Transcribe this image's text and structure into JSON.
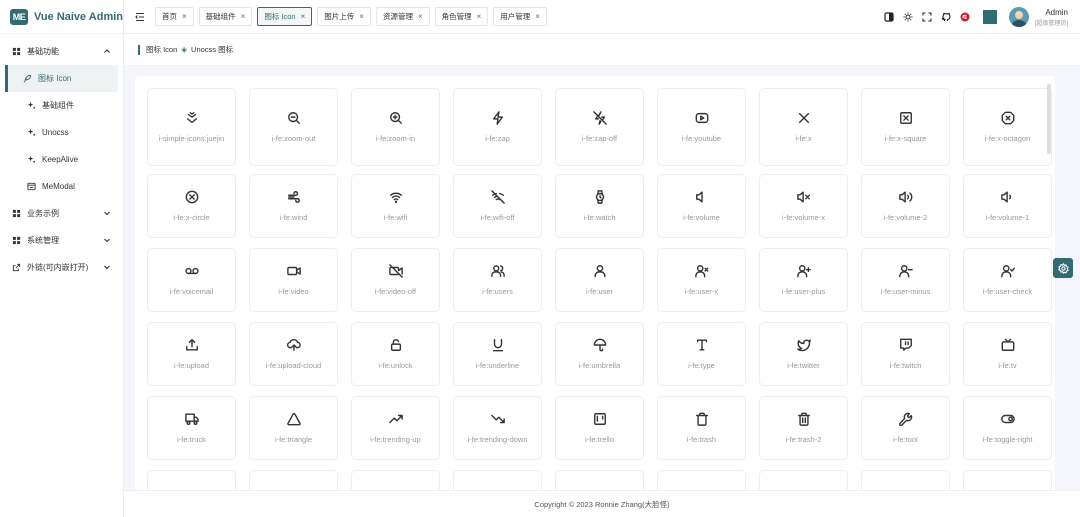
{
  "app": {
    "logo_badge": "ME",
    "title": "Vue Naive Admin"
  },
  "sidebar": {
    "items": [
      {
        "label": "基础功能",
        "level": 1,
        "icon": "grid-icon",
        "expanded": true
      },
      {
        "label": "图标 Icon",
        "level": 2,
        "icon": "feather-icon",
        "active": true
      },
      {
        "label": "基础组件",
        "level": 2,
        "icon": "sparkle-icon"
      },
      {
        "label": "Unocss",
        "level": 2,
        "icon": "sparkle-icon"
      },
      {
        "label": "KeepAlive",
        "level": 2,
        "icon": "sparkle-icon"
      },
      {
        "label": "MeModal",
        "level": 2,
        "icon": "window-icon"
      },
      {
        "label": "业务示例",
        "level": 1,
        "icon": "grid-icon"
      },
      {
        "label": "系统管理",
        "level": 1,
        "icon": "grid-icon"
      },
      {
        "label": "外链(可内嵌打开)",
        "level": 1,
        "icon": "external-link-icon"
      }
    ]
  },
  "tabs": [
    {
      "label": "首页"
    },
    {
      "label": "基础组件"
    },
    {
      "label": "图标 Icon",
      "active": true
    },
    {
      "label": "图片上传"
    },
    {
      "label": "资源管理"
    },
    {
      "label": "角色管理"
    },
    {
      "label": "用户管理"
    }
  ],
  "user": {
    "name": "Admin",
    "role": "[超级管理员]"
  },
  "breadcrumb": {
    "first": "图标 Icon",
    "second": "Unocss 图标"
  },
  "icons": [
    "i-simple-icons:juejin",
    "i-fe:zoom-out",
    "i-fe:zoom-in",
    "i-fe:zap",
    "i-fe:zap-off",
    "i-fe:youtube",
    "i-fe:x",
    "i-fe:x-square",
    "i-fe:x-octagon",
    "i-fe:x-circle",
    "i-fe:wind",
    "i-fe:wifi",
    "i-fe:wifi-off",
    "i-fe:watch",
    "i-fe:volume",
    "i-fe:volume-x",
    "i-fe:volume-2",
    "i-fe:volume-1",
    "i-fe:voicemail",
    "i-fe:video",
    "i-fe:video-off",
    "i-fe:users",
    "i-fe:user",
    "i-fe:user-x",
    "i-fe:user-plus",
    "i-fe:user-minus",
    "i-fe:user-check",
    "i-fe:upload",
    "i-fe:upload-cloud",
    "i-fe:unlock",
    "i-fe:underline",
    "i-fe:umbrella",
    "i-fe:type",
    "i-fe:twitter",
    "i-fe:twitch",
    "i-fe:tv",
    "i-fe:truck",
    "i-fe:triangle",
    "i-fe:trending-up",
    "i-fe:trending-down",
    "i-fe:trello",
    "i-fe:trash",
    "i-fe:trash-2",
    "i-fe:tool",
    "i-fe:toggle-right"
  ],
  "footer": {
    "copyright": "Copyright © 2023 Ronnie Zhang(大脸怪)"
  },
  "colors": {
    "accent": "#316c72"
  }
}
